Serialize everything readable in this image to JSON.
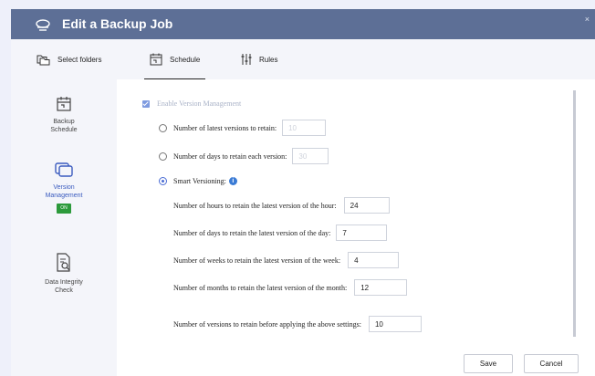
{
  "window": {
    "title": "Edit a Backup Job",
    "close_glyph": "×"
  },
  "tabs": [
    {
      "label": "Select folders",
      "icon": "folders-icon"
    },
    {
      "label": "Schedule",
      "icon": "calendar-icon",
      "active": true
    },
    {
      "label": "Rules",
      "icon": "sliders-icon"
    }
  ],
  "sidebar": {
    "items": [
      {
        "label_line1": "Backup",
        "label_line2": "Schedule",
        "icon": "calendar-icon"
      },
      {
        "label_line1": "Version",
        "label_line2": "Management",
        "badge": "ON",
        "active": true,
        "icon": "versions-icon"
      },
      {
        "label_line1": "Data Integrity",
        "label_line2": "Check",
        "icon": "document-check-icon"
      }
    ]
  },
  "version_management": {
    "enable_label": "Enable Version Management",
    "enabled": true,
    "option_latest": {
      "label": "Number of latest versions to retain:",
      "value": "10",
      "selected": false
    },
    "option_days": {
      "label": "Number of days to retain each version:",
      "value": "30",
      "selected": false
    },
    "option_smart": {
      "label": "Smart Versioning:",
      "selected": true
    },
    "smart_fields": {
      "hours": {
        "label": "Number of hours to retain the latest version of the hour:",
        "value": "24"
      },
      "days": {
        "label": "Number of days to retain the latest version of the day:",
        "value": "7"
      },
      "weeks": {
        "label": "Number of weeks to retain the latest version of the week:",
        "value": "4"
      },
      "months": {
        "label": "Number of months to retain the latest version of the month:",
        "value": "12"
      }
    },
    "before_applying": {
      "label": "Number of versions to retain before applying the above settings:",
      "value": "10"
    }
  },
  "buttons": {
    "save": "Save",
    "cancel": "Cancel"
  },
  "colors": {
    "titlebar": "#5d6f96",
    "accent": "#4a6cd4",
    "badge": "#2c9a3b",
    "info": "#3a7bd5"
  }
}
